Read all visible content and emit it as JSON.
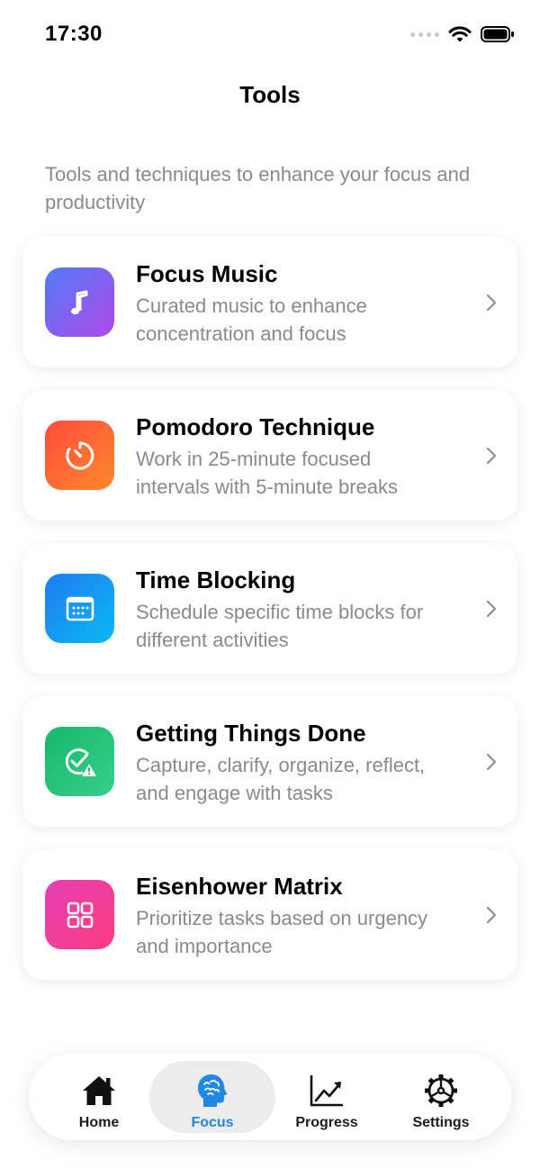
{
  "status_bar": {
    "time": "17:30"
  },
  "header": {
    "title": "Tools"
  },
  "subtitle": "Tools and techniques to enhance your focus and productivity",
  "tools": [
    {
      "title": "Focus Music",
      "description": "Curated music to enhance concentration and focus",
      "icon": "music-note-icon",
      "gradient": [
        "#4f7cf7",
        "#b049e8"
      ]
    },
    {
      "title": "Pomodoro Technique",
      "description": "Work in 25-minute focused intervals with 5-minute breaks",
      "icon": "timer-icon",
      "gradient": [
        "#ff4a3d",
        "#ff8a2b"
      ]
    },
    {
      "title": "Time Blocking",
      "description": "Schedule specific time blocks for different activities",
      "icon": "calendar-icon",
      "gradient": [
        "#1e7cf2",
        "#0bb8f5"
      ]
    },
    {
      "title": "Getting Things Done",
      "description": "Capture, clarify, organize, reflect, and engage with tasks",
      "icon": "check-warning-icon",
      "gradient": [
        "#17b86a",
        "#36cf8a"
      ]
    },
    {
      "title": "Eisenhower Matrix",
      "description": "Prioritize tasks based on urgency and importance",
      "icon": "grid-icon",
      "gradient": [
        "#e43fb6",
        "#ff3d7f"
      ]
    }
  ],
  "tab_bar": {
    "active": "Focus",
    "tabs": [
      {
        "label": "Home",
        "icon": "house-icon"
      },
      {
        "label": "Focus",
        "icon": "brain-head-icon"
      },
      {
        "label": "Progress",
        "icon": "chart-icon"
      },
      {
        "label": "Settings",
        "icon": "gear-icon"
      }
    ]
  },
  "colors": {
    "accent": "#1e88e5",
    "secondary_text": "#8a8a8e"
  }
}
